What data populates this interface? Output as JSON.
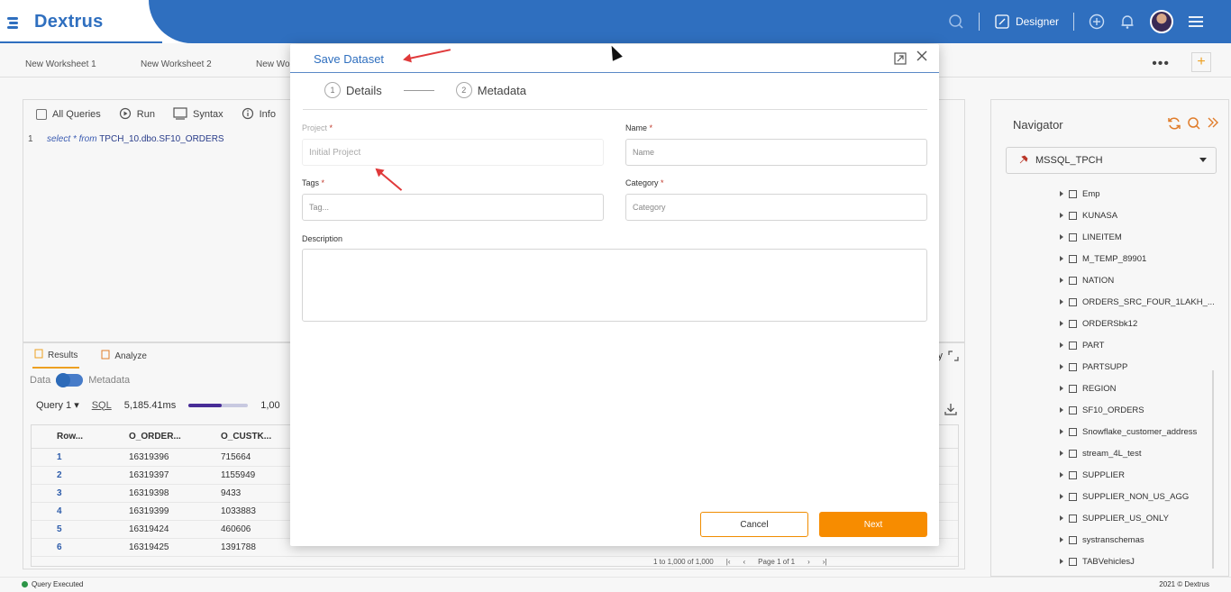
{
  "app": {
    "logo_text": "Dextrus"
  },
  "topbar": {
    "designer_label": "Designer"
  },
  "worksheets": {
    "tabs": [
      "New Worksheet 1",
      "New Worksheet 2",
      "New Wor"
    ],
    "more": "•••",
    "add": "+"
  },
  "editor": {
    "toolbar": {
      "all_queries": "All Queries",
      "run": "Run",
      "syntax": "Syntax",
      "info": "Info"
    },
    "line_number": "1",
    "code_keywords": "select * from",
    "code_rest": "TPCH_10.dbo.SF10_ORDERS"
  },
  "results": {
    "tabs": [
      "Results",
      "Analyze"
    ],
    "toggle_left": "Data",
    "toggle_right": "Metadata",
    "query_label": "Query 1",
    "sql_label": "SQL",
    "duration": "5,185.41ms",
    "count_partial": "1,00",
    "right_partial": "y",
    "columns": [
      "Row...",
      "O_ORDER...",
      "O_CUSTK..."
    ],
    "rows": [
      [
        "1",
        "16319396",
        "715664"
      ],
      [
        "2",
        "16319397",
        "1155949"
      ],
      [
        "3",
        "16319398",
        "9433"
      ],
      [
        "4",
        "16319399",
        "1033883"
      ],
      [
        "5",
        "16319424",
        "460606"
      ],
      [
        "6",
        "16319425",
        "1391788"
      ]
    ],
    "pagination": {
      "summary": "1 to 1,000 of 1,000",
      "page_label": "Page",
      "page": "1",
      "of_label": "of",
      "total": "1"
    }
  },
  "navigator": {
    "title": "Navigator",
    "connection": "MSSQL_TPCH",
    "items": [
      "Emp",
      "KUNASA",
      "LINEITEM",
      "M_TEMP_89901",
      "NATION",
      "ORDERS_SRC_FOUR_1LAKH_...",
      "ORDERSbk12",
      "PART",
      "PARTSUPP",
      "REGION",
      "SF10_ORDERS",
      "Snowflake_customer_address",
      "stream_4L_test",
      "SUPPLIER",
      "SUPPLIER_NON_US_AGG",
      "SUPPLIER_US_ONLY",
      "systranschemas",
      "TABVehiclesJ"
    ]
  },
  "status": {
    "left": "Query Executed",
    "right": "2021 © Dextrus"
  },
  "modal": {
    "title": "Save Dataset",
    "steps": [
      {
        "num": "1",
        "label": "Details"
      },
      {
        "num": "2",
        "label": "Metadata"
      }
    ],
    "project_label": "Project",
    "project_value": "Initial Project",
    "name_label": "Name",
    "name_placeholder": "Name",
    "tags_label": "Tags",
    "tags_placeholder": "Tag...",
    "category_label": "Category",
    "category_placeholder": "Category",
    "description_label": "Description",
    "required_mark": "*",
    "cancel_label": "Cancel",
    "next_label": "Next"
  },
  "colors": {
    "brand_blue": "#2f6fbf",
    "accent_orange": "#f78c00",
    "annotation_red": "#e0393a"
  }
}
